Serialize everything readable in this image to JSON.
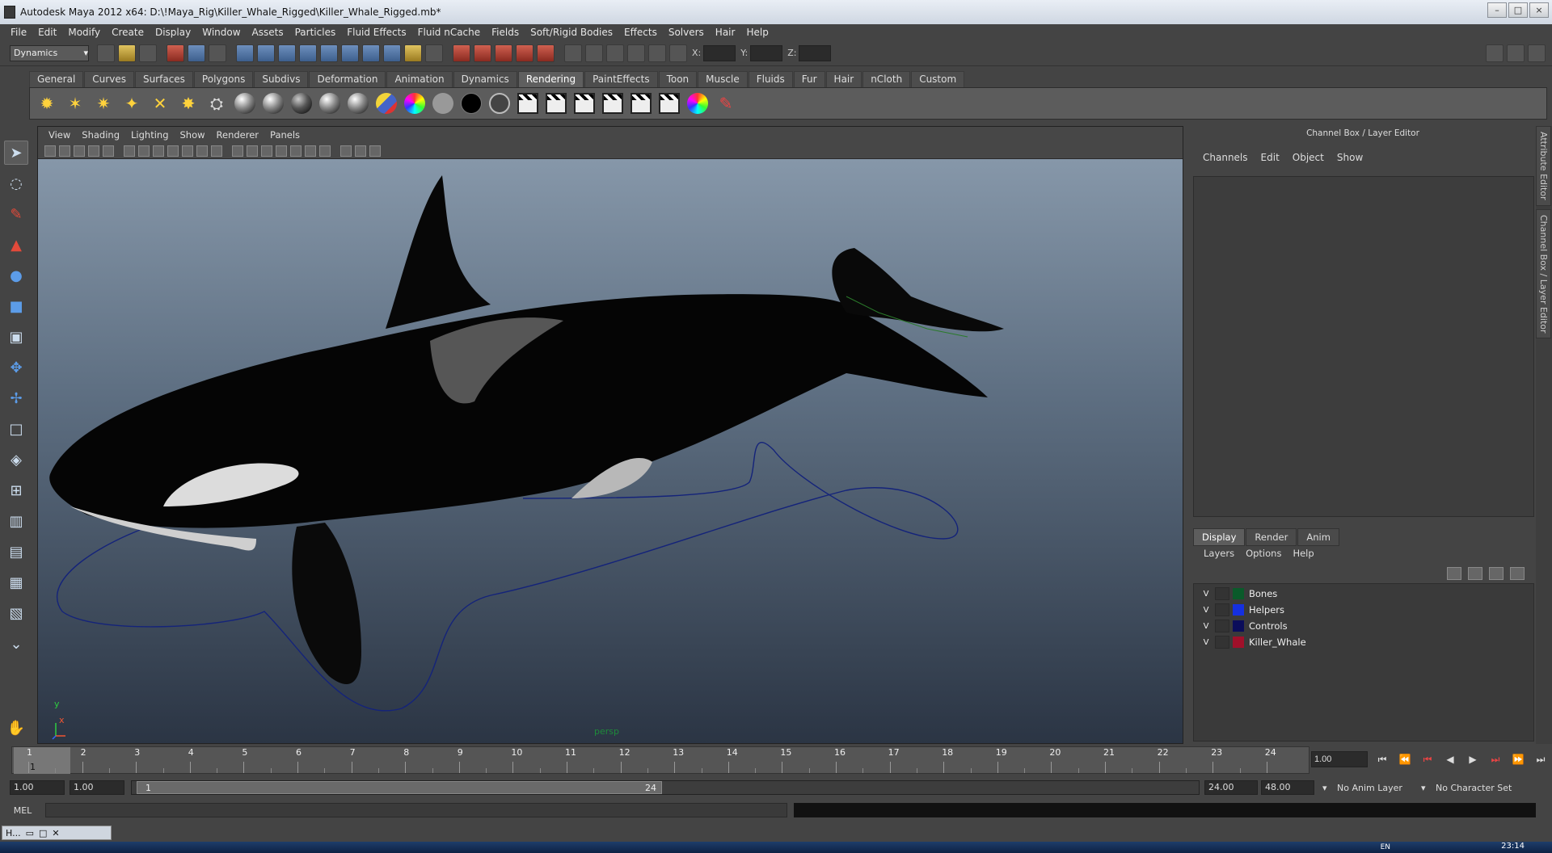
{
  "window": {
    "title": "Autodesk Maya 2012 x64: D:\\!Maya_Rig\\Killer_Whale_Rigged\\Killer_Whale_Rigged.mb*",
    "controls": [
      "–",
      "□",
      "×"
    ]
  },
  "menubar": [
    "File",
    "Edit",
    "Modify",
    "Create",
    "Display",
    "Window",
    "Assets",
    "Particles",
    "Fluid Effects",
    "Fluid nCache",
    "Fields",
    "Soft/Rigid Bodies",
    "Effects",
    "Solvers",
    "Hair",
    "Help"
  ],
  "statusline": {
    "mode": "Dynamics",
    "x_label": "X:",
    "y_label": "Y:",
    "z_label": "Z:"
  },
  "shelf": {
    "tabs": [
      "General",
      "Curves",
      "Surfaces",
      "Polygons",
      "Subdivs",
      "Deformation",
      "Animation",
      "Dynamics",
      "Rendering",
      "PaintEffects",
      "Toon",
      "Muscle",
      "Fluids",
      "Fur",
      "Hair",
      "nCloth",
      "Custom"
    ],
    "active_tab": "Rendering"
  },
  "viewport": {
    "menus": [
      "View",
      "Shading",
      "Lighting",
      "Show",
      "Renderer",
      "Panels"
    ],
    "camera": "persp",
    "axis_x": "x",
    "axis_y": "y"
  },
  "channel_box": {
    "title": "Channel Box / Layer Editor",
    "menus": [
      "Channels",
      "Edit",
      "Object",
      "Show"
    ]
  },
  "layer_editor": {
    "tabs": [
      "Display",
      "Render",
      "Anim"
    ],
    "active_tab": "Display",
    "menus": [
      "Layers",
      "Options",
      "Help"
    ],
    "layers": [
      {
        "visible": "V",
        "name": "Bones",
        "color": "#0a5a2a"
      },
      {
        "visible": "V",
        "name": "Helpers",
        "color": "#1530e0"
      },
      {
        "visible": "V",
        "name": "Controls",
        "color": "#0b0d5a"
      },
      {
        "visible": "V",
        "name": "Killer_Whale",
        "color": "#a0102a"
      }
    ]
  },
  "side_tabs": [
    "Attribute Editor",
    "Channel Box / Layer Editor"
  ],
  "timeline": {
    "ticks": [
      "1",
      "2",
      "3",
      "4",
      "5",
      "6",
      "7",
      "8",
      "9",
      "10",
      "11",
      "12",
      "13",
      "14",
      "15",
      "16",
      "17",
      "18",
      "19",
      "20",
      "21",
      "22",
      "23",
      "24"
    ],
    "current_frame": "1",
    "current_time_field": "1.00"
  },
  "range": {
    "start": "1.00",
    "playback_start": "1.00",
    "handle_start": "1",
    "handle_end": "24",
    "playback_end": "24.00",
    "end": "48.00",
    "anim_layer": "No Anim Layer",
    "character_set": "No Character Set"
  },
  "command_line": {
    "label": "MEL"
  },
  "taskbar": {
    "mini_label": "H...",
    "language": "EN",
    "clock": "23:14"
  }
}
